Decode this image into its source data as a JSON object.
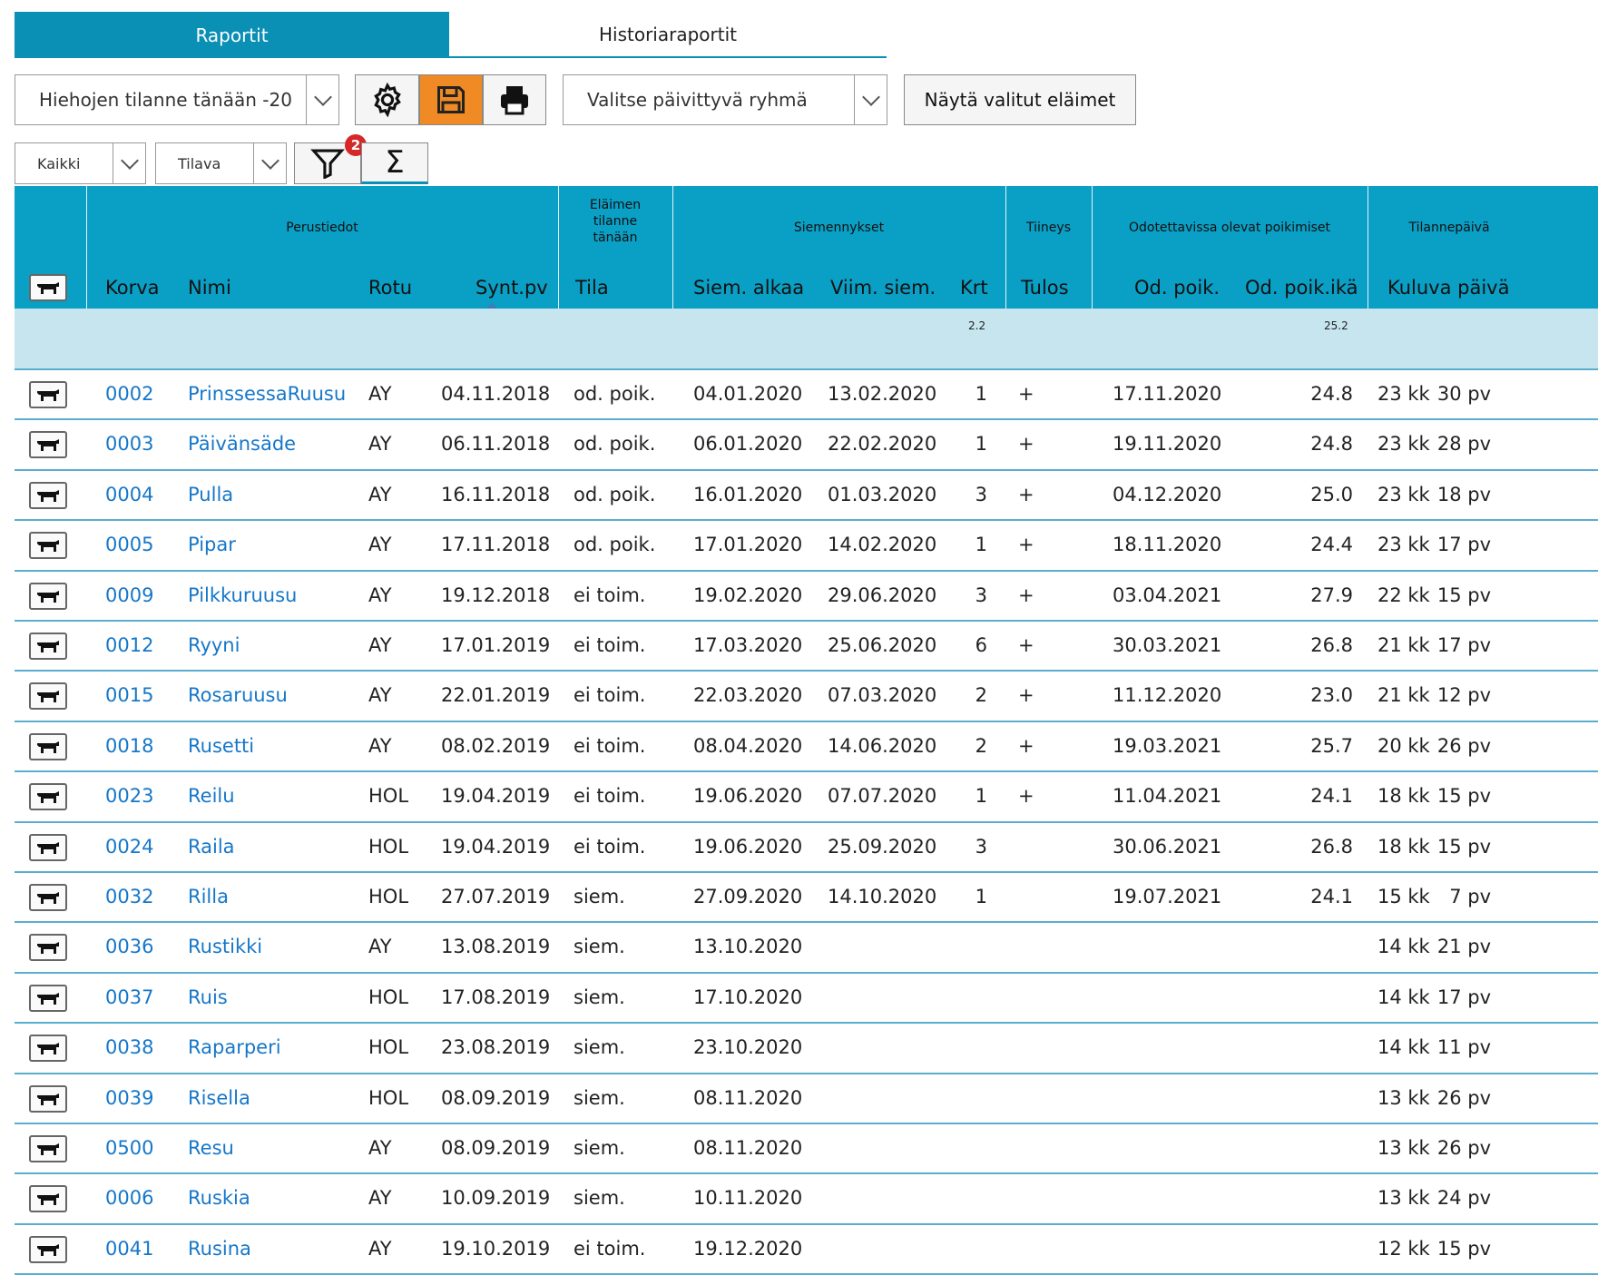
{
  "tabs": {
    "active": "Raportit",
    "inactive": "Historiaraportit"
  },
  "toolbar": {
    "report_select": "Hiehojen tilanne tänään -20",
    "group_select": "Valitse päivittyvä ryhmä",
    "show_selected_button": "Näytä valitut eläimet",
    "scope_select": "Kaikki",
    "location_select": "Tilava",
    "filter_badge": "2",
    "sum_symbol": "Σ"
  },
  "colors": {
    "header_bg": "#0a9fc5",
    "sum_row_bg": "#c6e5ee",
    "active_tab": "#0a8fb5",
    "save_button": "#f08a24",
    "link": "#1677c9"
  },
  "header_groups": {
    "perustiedot": "Perustiedot",
    "tilanne": [
      "Eläimen",
      "tilanne",
      "tänään"
    ],
    "siemennykset": "Siemennykset",
    "tiineys": "Tiineys",
    "poikimiset": "Odotettavissa olevat poikimiset",
    "tilannepaiva": "Tilannepäivä"
  },
  "columns": {
    "korva": "Korva",
    "nimi": "Nimi",
    "rotu": "Rotu",
    "synt": "Synt.pv",
    "tila": "Tila",
    "siem_alkaa": "Siem. alkaa",
    "viim_siem": "Viim. siem.",
    "krt": "Krt",
    "tulos": "Tulos",
    "od_poik": "Od. poik.",
    "od_poik_ika": "Od. poik.ikä",
    "kuluva": "Kuluva päivä"
  },
  "summary": {
    "krt": "2.2",
    "od_poik_ika": "25.2"
  },
  "rows": [
    {
      "korva": "0002",
      "nimi": "PrinssessaRuusu",
      "rotu": "AY",
      "synt": "04.11.2018",
      "tila": "od. poik.",
      "siem_alkaa": "04.01.2020",
      "viim_siem": "13.02.2020",
      "krt": "1",
      "tulos": "+",
      "od_poik": "17.11.2020",
      "od_poik_ika": "24.8",
      "kk": "23 kk",
      "pv": "30 pv"
    },
    {
      "korva": "0003",
      "nimi": "Päivänsäde",
      "rotu": "AY",
      "synt": "06.11.2018",
      "tila": "od. poik.",
      "siem_alkaa": "06.01.2020",
      "viim_siem": "22.02.2020",
      "krt": "1",
      "tulos": "+",
      "od_poik": "19.11.2020",
      "od_poik_ika": "24.8",
      "kk": "23 kk",
      "pv": "28 pv"
    },
    {
      "korva": "0004",
      "nimi": "Pulla",
      "rotu": "AY",
      "synt": "16.11.2018",
      "tila": "od. poik.",
      "siem_alkaa": "16.01.2020",
      "viim_siem": "01.03.2020",
      "krt": "3",
      "tulos": "+",
      "od_poik": "04.12.2020",
      "od_poik_ika": "25.0",
      "kk": "23 kk",
      "pv": "18 pv"
    },
    {
      "korva": "0005",
      "nimi": "Pipar",
      "rotu": "AY",
      "synt": "17.11.2018",
      "tila": "od. poik.",
      "siem_alkaa": "17.01.2020",
      "viim_siem": "14.02.2020",
      "krt": "1",
      "tulos": "+",
      "od_poik": "18.11.2020",
      "od_poik_ika": "24.4",
      "kk": "23 kk",
      "pv": "17 pv"
    },
    {
      "korva": "0009",
      "nimi": "Pilkkuruusu",
      "rotu": "AY",
      "synt": "19.12.2018",
      "tila": "ei toim.",
      "siem_alkaa": "19.02.2020",
      "viim_siem": "29.06.2020",
      "krt": "3",
      "tulos": "+",
      "od_poik": "03.04.2021",
      "od_poik_ika": "27.9",
      "kk": "22 kk",
      "pv": "15 pv"
    },
    {
      "korva": "0012",
      "nimi": "Ryyni",
      "rotu": "AY",
      "synt": "17.01.2019",
      "tila": "ei toim.",
      "siem_alkaa": "17.03.2020",
      "viim_siem": "25.06.2020",
      "krt": "6",
      "tulos": "+",
      "od_poik": "30.03.2021",
      "od_poik_ika": "26.8",
      "kk": "21 kk",
      "pv": "17 pv"
    },
    {
      "korva": "0015",
      "nimi": "Rosaruusu",
      "rotu": "AY",
      "synt": "22.01.2019",
      "tila": "ei toim.",
      "siem_alkaa": "22.03.2020",
      "viim_siem": "07.03.2020",
      "krt": "2",
      "tulos": "+",
      "od_poik": "11.12.2020",
      "od_poik_ika": "23.0",
      "kk": "21 kk",
      "pv": "12 pv"
    },
    {
      "korva": "0018",
      "nimi": "Rusetti",
      "rotu": "AY",
      "synt": "08.02.2019",
      "tila": "ei toim.",
      "siem_alkaa": "08.04.2020",
      "viim_siem": "14.06.2020",
      "krt": "2",
      "tulos": "+",
      "od_poik": "19.03.2021",
      "od_poik_ika": "25.7",
      "kk": "20 kk",
      "pv": "26 pv"
    },
    {
      "korva": "0023",
      "nimi": "Reilu",
      "rotu": "HOL",
      "synt": "19.04.2019",
      "tila": "ei toim.",
      "siem_alkaa": "19.06.2020",
      "viim_siem": "07.07.2020",
      "krt": "1",
      "tulos": "+",
      "od_poik": "11.04.2021",
      "od_poik_ika": "24.1",
      "kk": "18 kk",
      "pv": "15 pv"
    },
    {
      "korva": "0024",
      "nimi": "Raila",
      "rotu": "HOL",
      "synt": "19.04.2019",
      "tila": "ei toim.",
      "siem_alkaa": "19.06.2020",
      "viim_siem": "25.09.2020",
      "krt": "3",
      "tulos": "",
      "od_poik": "30.06.2021",
      "od_poik_ika": "26.8",
      "kk": "18 kk",
      "pv": "15 pv"
    },
    {
      "korva": "0032",
      "nimi": "Rilla",
      "rotu": "HOL",
      "synt": "27.07.2019",
      "tila": "siem.",
      "siem_alkaa": "27.09.2020",
      "viim_siem": "14.10.2020",
      "krt": "1",
      "tulos": "",
      "od_poik": "19.07.2021",
      "od_poik_ika": "24.1",
      "kk": "15 kk",
      "pv": "7 pv"
    },
    {
      "korva": "0036",
      "nimi": "Rustikki",
      "rotu": "AY",
      "synt": "13.08.2019",
      "tila": "siem.",
      "siem_alkaa": "13.10.2020",
      "viim_siem": "",
      "krt": "",
      "tulos": "",
      "od_poik": "",
      "od_poik_ika": "",
      "kk": "14 kk",
      "pv": "21 pv"
    },
    {
      "korva": "0037",
      "nimi": "Ruis",
      "rotu": "HOL",
      "synt": "17.08.2019",
      "tila": "siem.",
      "siem_alkaa": "17.10.2020",
      "viim_siem": "",
      "krt": "",
      "tulos": "",
      "od_poik": "",
      "od_poik_ika": "",
      "kk": "14 kk",
      "pv": "17 pv"
    },
    {
      "korva": "0038",
      "nimi": "Raparperi",
      "rotu": "HOL",
      "synt": "23.08.2019",
      "tila": "siem.",
      "siem_alkaa": "23.10.2020",
      "viim_siem": "",
      "krt": "",
      "tulos": "",
      "od_poik": "",
      "od_poik_ika": "",
      "kk": "14 kk",
      "pv": "11 pv"
    },
    {
      "korva": "0039",
      "nimi": "Risella",
      "rotu": "HOL",
      "synt": "08.09.2019",
      "tila": "siem.",
      "siem_alkaa": "08.11.2020",
      "viim_siem": "",
      "krt": "",
      "tulos": "",
      "od_poik": "",
      "od_poik_ika": "",
      "kk": "13 kk",
      "pv": "26 pv"
    },
    {
      "korva": "0500",
      "nimi": "Resu",
      "rotu": "AY",
      "synt": "08.09.2019",
      "tila": "siem.",
      "siem_alkaa": "08.11.2020",
      "viim_siem": "",
      "krt": "",
      "tulos": "",
      "od_poik": "",
      "od_poik_ika": "",
      "kk": "13 kk",
      "pv": "26 pv"
    },
    {
      "korva": "0006",
      "nimi": "Ruskia",
      "rotu": "AY",
      "synt": "10.09.2019",
      "tila": "siem.",
      "siem_alkaa": "10.11.2020",
      "viim_siem": "",
      "krt": "",
      "tulos": "",
      "od_poik": "",
      "od_poik_ika": "",
      "kk": "13 kk",
      "pv": "24 pv"
    },
    {
      "korva": "0041",
      "nimi": "Rusina",
      "rotu": "AY",
      "synt": "19.10.2019",
      "tila": "ei toim.",
      "siem_alkaa": "19.12.2020",
      "viim_siem": "",
      "krt": "",
      "tulos": "",
      "od_poik": "",
      "od_poik_ika": "",
      "kk": "12 kk",
      "pv": "15 pv"
    }
  ]
}
